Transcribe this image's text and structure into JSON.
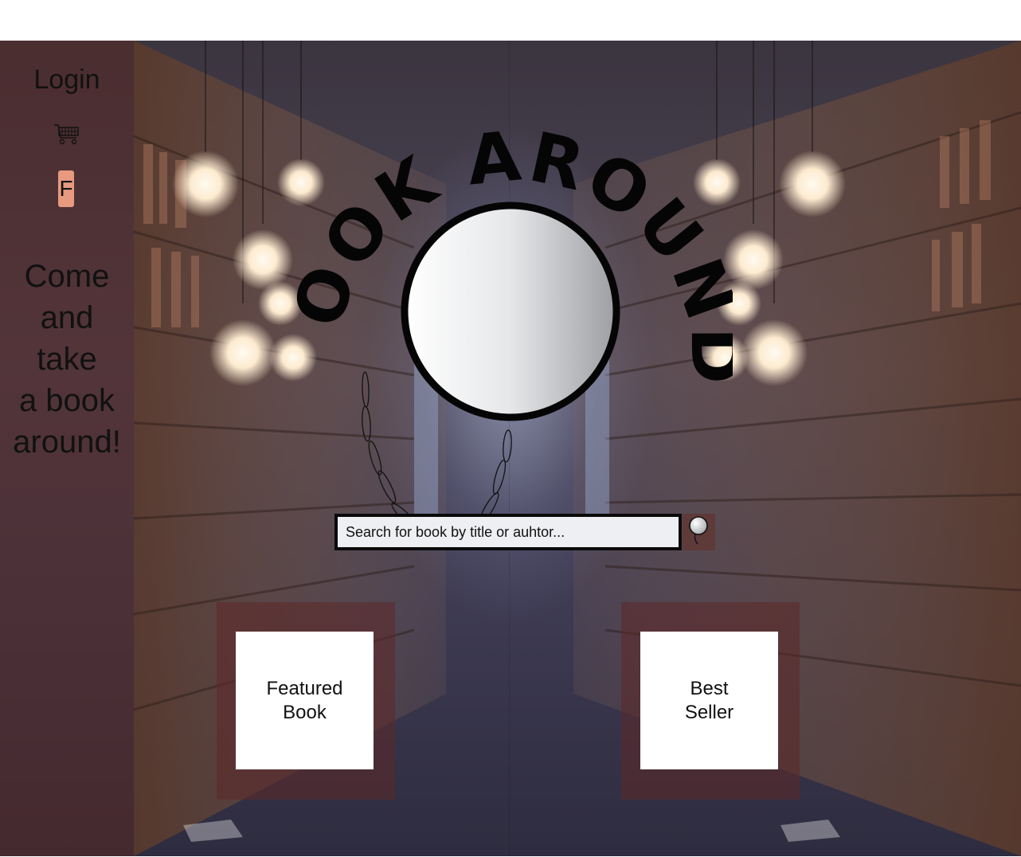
{
  "sidebar": {
    "login_label": "Login",
    "cart_icon": "shopping-cart-icon",
    "social_icon": "facebook-icon",
    "social_label": "F",
    "tagline": [
      "Come",
      "and",
      "take",
      "a book",
      "around!"
    ]
  },
  "logo": {
    "text": "BOOK AROUND",
    "icon": "magnifying-glass-icon"
  },
  "search": {
    "placeholder": "Search for book by title or auhtor...",
    "button_icon": "search-icon"
  },
  "cards": {
    "featured": [
      "Featured",
      "Book"
    ],
    "bestseller": [
      "Best",
      "Seller"
    ]
  },
  "colors": {
    "sidebar_overlay": "#582822",
    "social_badge": "#e79a7f",
    "search_button": "#5e3a38",
    "card_frame": "#5c2828"
  }
}
